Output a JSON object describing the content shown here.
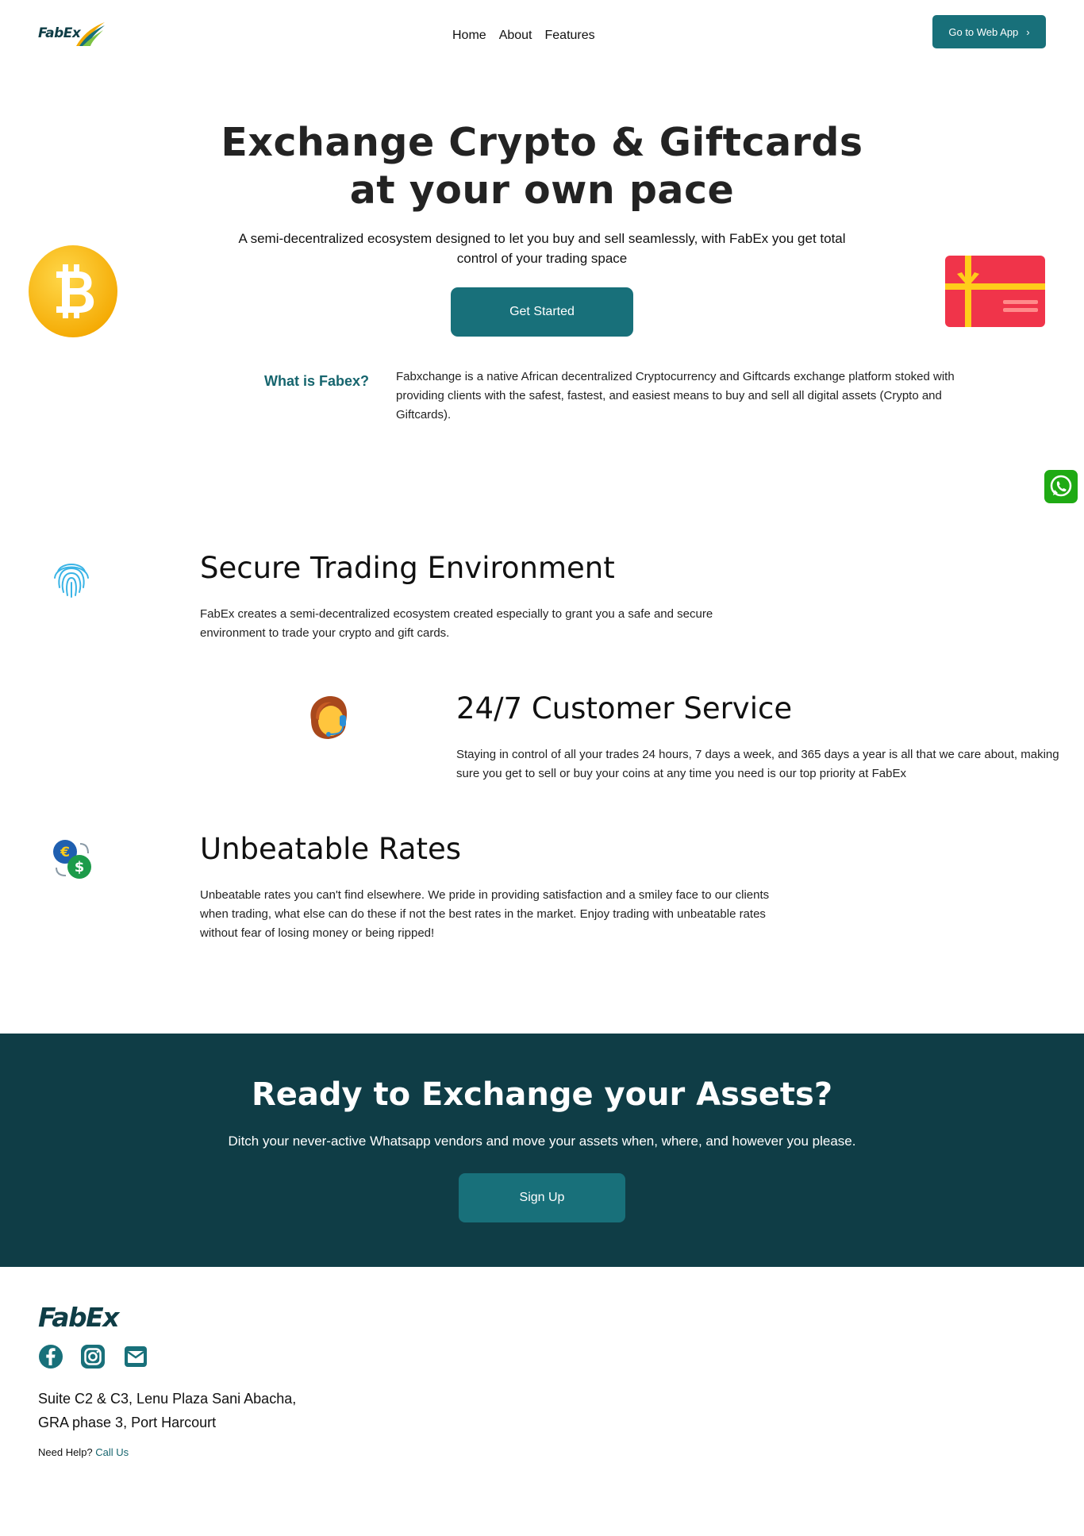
{
  "header": {
    "logo_text": "FabEx",
    "nav": [
      "Home",
      "About",
      "Features"
    ],
    "webapp_label": "Go to Web App",
    "webapp_chevron": "›"
  },
  "hero": {
    "title_line1": "Exchange Crypto & Giftcards",
    "title_line2": "at your own pace",
    "subtitle": "A semi-decentralized ecosystem designed to let you buy and sell seamlessly, with FabEx you get total control of your trading space",
    "cta_label": "Get Started",
    "left_icon": "bitcoin-coin-icon",
    "right_icon": "gift-card-icon"
  },
  "about": {
    "label": "What is Fabex?",
    "text": "Fabxchange is a native African decentralized Cryptocurrency and Giftcards exchange platform stoked with providing clients with the safest, fastest, and easiest means to buy and sell all digital assets (Crypto and Giftcards)."
  },
  "floating": {
    "icon": "whatsapp-icon"
  },
  "features": [
    {
      "icon": "fingerprint-icon",
      "title": "Secure Trading Environment",
      "text": "FabEx creates a semi-decentralized ecosystem created especially to grant you a safe and secure environment to trade your crypto and gift cards."
    },
    {
      "icon": "customer-support-icon",
      "title": "24/7 Customer Service",
      "text": "Staying in control of all your trades 24 hours, 7 days a week, and 365 days a year is all that we care about, making sure you get to sell or buy your coins at any time you need is our top priority at FabEx"
    },
    {
      "icon": "currency-exchange-icon",
      "title": "Unbeatable Rates",
      "text": "Unbeatable rates you can't find elsewhere. We pride in providing satisfaction and a smiley face to our clients when trading, what else can do these if not the best rates in the market. Enjoy trading with unbeatable rates without fear of losing money or being ripped!"
    }
  ],
  "cta": {
    "title": "Ready to Exchange your Assets?",
    "subtitle": "Ditch your never-active Whatsapp vendors and move your assets when, where, and however you please.",
    "button_label": "Sign Up"
  },
  "footer": {
    "logo_text": "FabEx",
    "social_icons": [
      "facebook-icon",
      "instagram-icon",
      "mail-icon"
    ],
    "address_line1": "Suite C2 & C3, Lenu Plaza Sani Abacha,",
    "address_line2": "GRA phase 3, Port Harcourt",
    "help_label": "Need Help?",
    "help_link": "Call Us"
  },
  "colors": {
    "primary": "#18707a",
    "dark": "#0f3d46",
    "bitcoin": "#f7b500",
    "giftcard": "#f0344a",
    "whatsapp": "#1faa14"
  }
}
